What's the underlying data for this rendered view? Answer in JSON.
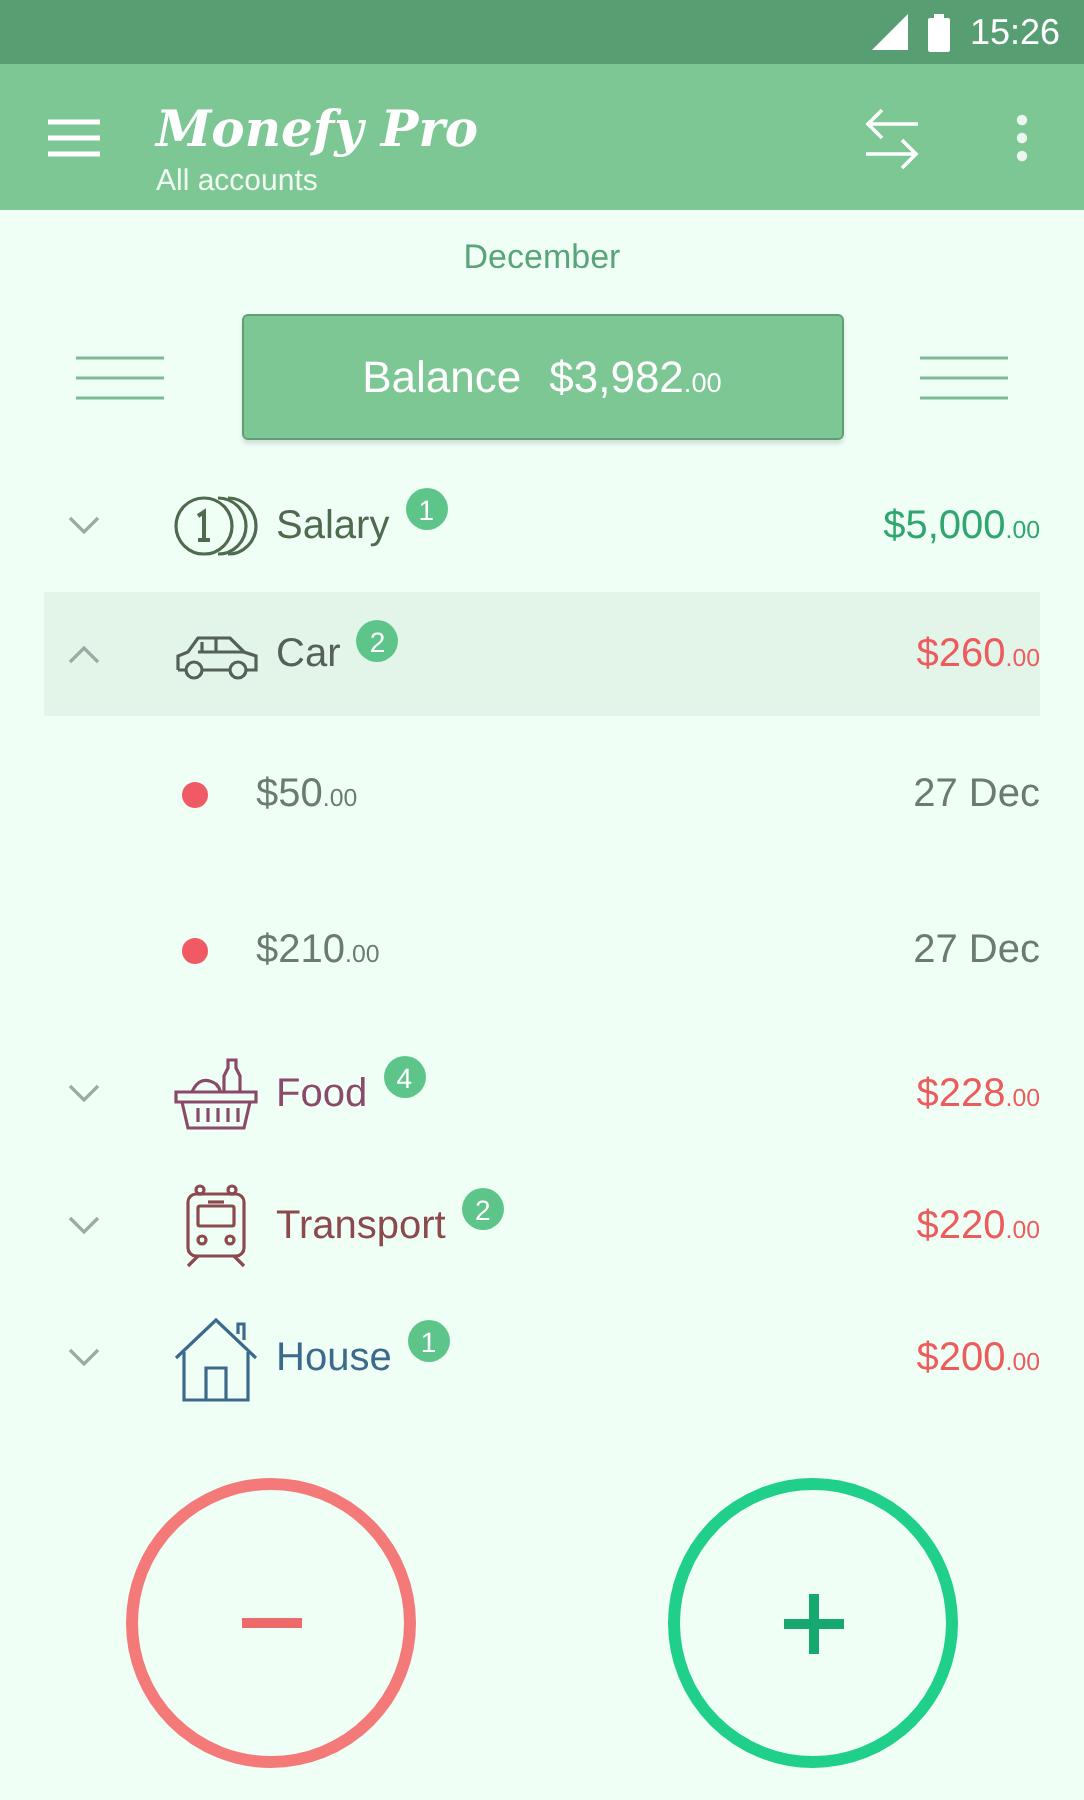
{
  "status_bar": {
    "time": "15:26"
  },
  "app_bar": {
    "title": "Monefy Pro",
    "subtitle": "All accounts"
  },
  "period": "December",
  "balance": {
    "label": "Balance",
    "amount": "$3,982",
    "cents": ".00"
  },
  "categories": [
    {
      "name": "Salary",
      "kind": "coins",
      "color": "#4f6b4f",
      "count": "1",
      "income": true,
      "amount": "$5,000",
      "cents": ".00",
      "expanded": false
    },
    {
      "name": "Car",
      "kind": "car",
      "color": "#55605a",
      "count": "2",
      "income": false,
      "amount": "$260",
      "cents": ".00",
      "expanded": true,
      "children": [
        {
          "amount": "$50",
          "cents": ".00",
          "date": "27 Dec",
          "color": "#f05a64"
        },
        {
          "amount": "$210",
          "cents": ".00",
          "date": "27 Dec",
          "color": "#f05a64"
        }
      ]
    },
    {
      "name": "Food",
      "kind": "basket",
      "color": "#8a4a6a",
      "count": "4",
      "income": false,
      "amount": "$228",
      "cents": ".00",
      "expanded": false
    },
    {
      "name": "Transport",
      "kind": "train",
      "color": "#8a4a4e",
      "count": "2",
      "income": false,
      "amount": "$220",
      "cents": ".00",
      "expanded": false
    },
    {
      "name": "House",
      "kind": "house",
      "color": "#3d6a8c",
      "count": "1",
      "income": false,
      "amount": "$200",
      "cents": ".00",
      "expanded": false
    }
  ],
  "actions": [
    {
      "kind": "expense"
    },
    {
      "kind": "income"
    }
  ]
}
